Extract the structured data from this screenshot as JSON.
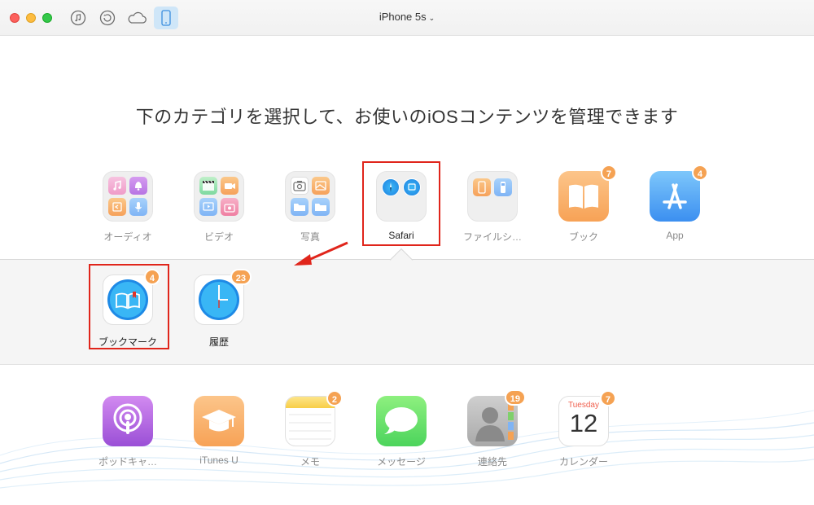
{
  "window": {
    "device_name": "iPhone 5s"
  },
  "toolbar": {
    "buttons": [
      {
        "icon": "music-note-icon"
      },
      {
        "icon": "history-icon"
      },
      {
        "icon": "cloud-icon"
      },
      {
        "icon": "iphone-icon",
        "active": true
      }
    ]
  },
  "heading": "下のカテゴリを選択して、お使いのiOSコンテンツを管理できます",
  "categories_top": [
    {
      "label": "オーディオ"
    },
    {
      "label": "ビデオ"
    },
    {
      "label": "写真"
    },
    {
      "label": "Safari",
      "selected": true
    },
    {
      "label": "ファイルシ…"
    },
    {
      "label": "ブック",
      "badge": "7"
    },
    {
      "label": "App",
      "badge": "4"
    }
  ],
  "safari_items": [
    {
      "label": "ブックマーク",
      "badge": "4"
    },
    {
      "label": "履歴",
      "badge": "23"
    }
  ],
  "categories_bottom": [
    {
      "label": "ポッドキャ…"
    },
    {
      "label": "iTunes U"
    },
    {
      "label": "メモ",
      "badge": "2"
    },
    {
      "label": "メッセージ"
    },
    {
      "label": "連絡先",
      "badge": "19"
    },
    {
      "label": "カレンダー",
      "badge": "7",
      "calendar_day": "Tuesday",
      "calendar_date": "12"
    }
  ],
  "colors": {
    "highlight": "#e0251b",
    "badge": "#f5a253",
    "active_tab": "#cfe6f8"
  }
}
